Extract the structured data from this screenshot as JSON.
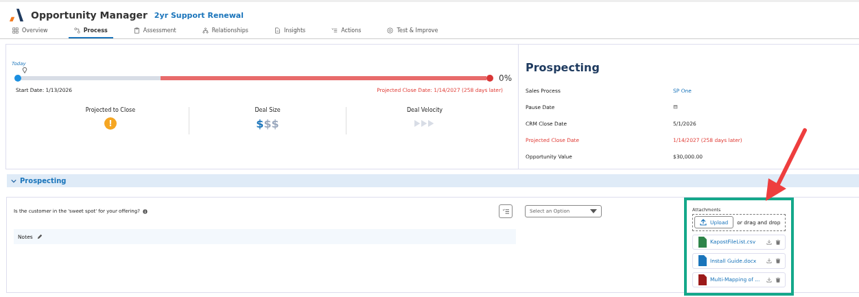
{
  "app": {
    "title": "Opportunity Manager",
    "record": "2yr Support Renewal"
  },
  "tabs": [
    {
      "label": "Overview",
      "selected": false
    },
    {
      "label": "Process",
      "selected": true
    },
    {
      "label": "Assessment",
      "selected": false
    },
    {
      "label": "Relationships",
      "selected": false
    },
    {
      "label": "Insights",
      "selected": false
    },
    {
      "label": "Actions",
      "selected": false
    },
    {
      "label": "Test & Improve",
      "selected": false
    }
  ],
  "timeline": {
    "today_label": "Today",
    "percent": "0%",
    "start": "Start Date: 1/13/2026",
    "projected": "Projected Close Date: 1/14/2027 (258 days later)"
  },
  "metrics": [
    {
      "label": "Projected to Close",
      "kind": "warning",
      "warning": "!"
    },
    {
      "label": "Deal Size",
      "kind": "dollars",
      "symbols": [
        {
          "text": "$",
          "active": true
        },
        {
          "text": "$",
          "active": false
        },
        {
          "text": "$",
          "active": false
        }
      ]
    },
    {
      "label": "Deal Velocity",
      "kind": "arrows",
      "arrows": [
        {
          "active": false
        },
        {
          "active": false
        },
        {
          "active": false
        }
      ]
    }
  ],
  "stage": {
    "title": "Prospecting",
    "fields": [
      {
        "label": "Sales Process",
        "value": "SP One",
        "kind": "link",
        "alert": false
      },
      {
        "label": "Pause Date",
        "kind": "date",
        "alert": false
      },
      {
        "label": "CRM Close Date",
        "value": "5/1/2026",
        "kind": "text",
        "alert": false
      },
      {
        "label": "Projected Close Date",
        "value": "1/14/2027 (258 days later)",
        "kind": "text",
        "alert": true
      },
      {
        "label": "Opportunity Value",
        "value": "$30,000.00",
        "kind": "text",
        "alert": false
      }
    ]
  },
  "section": {
    "title": "Prospecting",
    "expanded": true
  },
  "question": {
    "text": "Is the customer in the 'sweet spot' for your offering?",
    "notes_label": "Notes",
    "select_placeholder": "Select an Option"
  },
  "attachments": {
    "title": "Attachments",
    "upload": "Upload",
    "drop_hint": "or drag and drop",
    "highlighted": true,
    "files": [
      {
        "name": "KapostFileList.csv",
        "color": "#2e844a"
      },
      {
        "name": "Install Guide.docx",
        "color": "#1b75bb"
      },
      {
        "name": "Multi-Mapping of ...",
        "color": "#9c1a1a"
      }
    ]
  }
}
